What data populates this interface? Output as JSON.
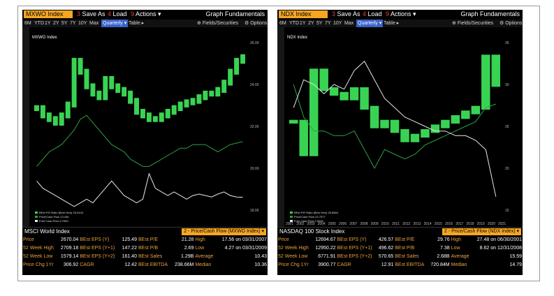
{
  "panels": [
    {
      "ticker": "MXWO Index",
      "toolbar": [
        {
          "num": "3",
          "label": "Save As"
        },
        {
          "num": "4",
          "label": "Load"
        },
        {
          "num": "9",
          "label": "Actions"
        }
      ],
      "view_title": "Graph Fundamentals",
      "ranges": [
        "6M",
        "YTD",
        "1Y",
        "2Y",
        "5Y",
        "7Y",
        "10Y",
        "Max"
      ],
      "periodicity": "Quarterly",
      "table_label": "Table",
      "fields_label": "Fields/Securities",
      "options_label": "Options",
      "chart_title": "MXWO Index",
      "y_ticks": [
        "26.00",
        "24.00",
        "22.00",
        "20.00",
        "18.00"
      ],
      "legend": [
        "BEst P/E Ratio (Best Vers) 25.0443",
        "Price/Cash Flow 13.446",
        "Free Cash Flow 5.7699"
      ],
      "index_name": "MSCI World Index",
      "dropdown": "2 - Price/Cash Flow (MXWO Index)",
      "stats": [
        [
          "Price",
          "2670.04",
          "BEst EPS (Y)",
          "125.49",
          "BEst P/E",
          "21.28",
          "High",
          "17.56 on 03/31/2007"
        ],
        [
          "52 Week High",
          "2709.18",
          "BEst EPS (Y+1)",
          "147.22",
          "BEst P/B",
          "2.69",
          "Low",
          "4.27 on 03/31/2009"
        ],
        [
          "52 Week Low",
          "1579.14",
          "BEst EPS (Y+2)",
          "161.40",
          "BEst Sales",
          "1.29B",
          "Average",
          "10.43"
        ],
        [
          "Price Chg 1Yr",
          "306.92",
          "CAGR",
          "12.42",
          "BEst EBITDA",
          "238.66M",
          "Median",
          "10.36"
        ]
      ]
    },
    {
      "ticker": "NDX Index",
      "toolbar": [
        {
          "num": "3",
          "label": "Save As"
        },
        {
          "num": "4",
          "label": "Load"
        },
        {
          "num": "9",
          "label": "Actions"
        }
      ],
      "view_title": "Graph Fundamentals",
      "ranges": [
        "6M",
        "YTD",
        "1Y",
        "2Y",
        "5Y",
        "7Y",
        "10Y",
        "Max"
      ],
      "periodicity": "Quarterly",
      "table_label": "Table",
      "fields_label": "Fields/Securities",
      "options_label": "Options",
      "chart_title": "NDX Index",
      "y_ticks": [
        "35",
        "30",
        "25",
        "20",
        "15"
      ],
      "legend": [
        "BEst P/E Ratio (Best Vers) 26.8664",
        "Price/Cash Flow 22.7577",
        "Free Cash Flow 2.9026"
      ],
      "x_years": [
        "2001",
        "2002",
        "2003",
        "2004",
        "2005",
        "2006",
        "2007",
        "2008",
        "2009",
        "2010",
        "2011",
        "2012",
        "2013",
        "2014",
        "2015",
        "2016",
        "2017",
        "2018",
        "2019",
        "2020",
        "2021"
      ],
      "index_name": "NASDAQ 100 Stock Index",
      "dropdown": "2 - Price/Cash Flow (NDX Index)",
      "stats": [
        [
          "Price",
          "12694.67",
          "BEst EPS (Y)",
          "426.57",
          "BEst P/E",
          "29.76",
          "High",
          "27.48 on 06/30/2001"
        ],
        [
          "52 Week High",
          "12950.22",
          "BEst EPS (Y+1)",
          "496.62",
          "BEst P/B",
          "7.38",
          "Low",
          "8.62 on 12/31/2008"
        ],
        [
          "52 Week Low",
          "6771.91",
          "BEst EPS (Y+2)",
          "570.65",
          "BEst Sales",
          "2.68B",
          "Average",
          "15.59"
        ],
        [
          "Price Chg 1Yr",
          "3900.77",
          "CAGR",
          "12.91",
          "BEst EBITDA",
          "720.84M",
          "Median",
          "14.79"
        ]
      ]
    }
  ],
  "colors": {
    "bar_green": "#39d353",
    "line_green": "#2ea043",
    "line_white": "#e8e8e8",
    "accent_orange": "#f5a623",
    "label_orange": "#e8a040",
    "range_selected": "#3a62c8"
  },
  "chart_data": [
    {
      "type": "bar",
      "title": "MXWO Index",
      "series": [
        {
          "name": "BEst P/E Ratio (Best Vers)",
          "values": [
            18,
            17,
            16.5,
            16,
            17,
            18.5,
            24.5,
            23,
            21,
            20,
            19.5,
            22,
            21,
            20.5,
            20,
            19,
            17.5,
            17,
            16.5,
            16.5,
            17,
            17.5,
            18,
            18.5,
            18.8,
            19,
            19.5,
            20,
            20,
            20.5,
            21.5,
            23,
            24.5,
            25
          ]
        },
        {
          "name": "Price/Cash Flow",
          "values": [
            10,
            11,
            12,
            12.5,
            13,
            14,
            15,
            16.5,
            17,
            16,
            15,
            14,
            13,
            12.5,
            12,
            11,
            10.5,
            10,
            10,
            10.5,
            11,
            11.5,
            12,
            12.5,
            12.5,
            13,
            13,
            13,
            12.5,
            12,
            12.5,
            13,
            13.2,
            13.4
          ]
        },
        {
          "name": "Free Cash Flow",
          "values": [
            8,
            7,
            6.5,
            6,
            5.5,
            5,
            4.5,
            5,
            5.5,
            5,
            6,
            7,
            8,
            7,
            6,
            5.5,
            5,
            5.5,
            9,
            7,
            6.5,
            6,
            6.5,
            6,
            5.5,
            6,
            6.2,
            6,
            5.8,
            6.2,
            6.5,
            6,
            5.8,
            5.77
          ]
        }
      ]
    },
    {
      "type": "bar",
      "title": "NDX Index",
      "categories": [
        "2001",
        "2002",
        "2003",
        "2004",
        "2005",
        "2006",
        "2007",
        "2008",
        "2009",
        "2010",
        "2011",
        "2012",
        "2013",
        "2014",
        "2015",
        "2016",
        "2017",
        "2018",
        "2019",
        "2020",
        "2021"
      ],
      "series": [
        {
          "name": "BEst P/E Ratio (Best Vers)",
          "values": [
            19,
            12,
            30,
            26,
            25,
            24,
            26,
            22,
            18,
            19,
            17,
            15,
            16,
            17,
            18,
            19,
            20,
            21,
            22,
            33,
            26.9
          ]
        },
        {
          "name": "Price/Cash Flow",
          "values": [
            27,
            20,
            17,
            17,
            16,
            16,
            17,
            13,
            9,
            13,
            12,
            11,
            12,
            14,
            15,
            16,
            17,
            18,
            19,
            22,
            22.8
          ]
        },
        {
          "name": "Free Cash Flow",
          "values": [
            22,
            28,
            27,
            25,
            27,
            26,
            30,
            32,
            28,
            24,
            22,
            20,
            19,
            18,
            17,
            17,
            16,
            16,
            15,
            13,
            2.9
          ]
        }
      ]
    }
  ]
}
